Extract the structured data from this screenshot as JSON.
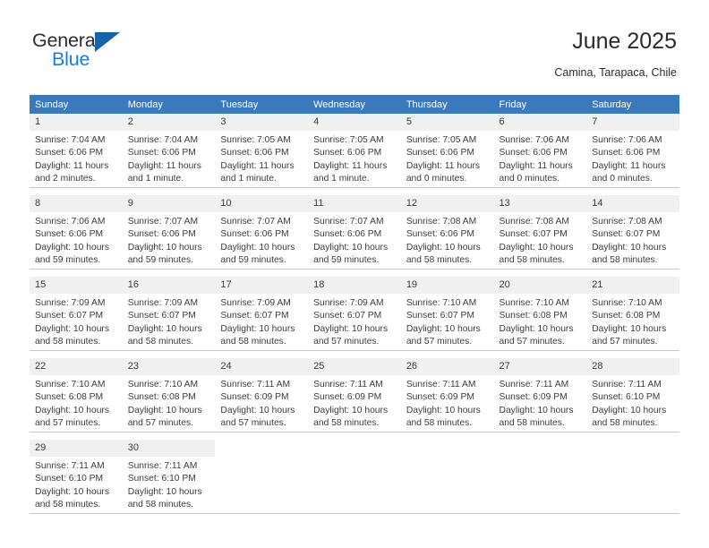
{
  "brand": {
    "name_top": "General",
    "name_bottom": "Blue",
    "accent_color": "#1a7fd4",
    "triangle_color": "#1565a8"
  },
  "header": {
    "title": "June 2025",
    "location": "Camina, Tarapaca, Chile"
  },
  "calendar": {
    "header_bg": "#3b79bd",
    "daynum_bg": "#f0f0f0",
    "weekdays": [
      "Sunday",
      "Monday",
      "Tuesday",
      "Wednesday",
      "Thursday",
      "Friday",
      "Saturday"
    ],
    "weeks": [
      [
        {
          "day": "1",
          "sunrise": "Sunrise: 7:04 AM",
          "sunset": "Sunset: 6:06 PM",
          "daylight1": "Daylight: 11 hours",
          "daylight2": "and 2 minutes."
        },
        {
          "day": "2",
          "sunrise": "Sunrise: 7:04 AM",
          "sunset": "Sunset: 6:06 PM",
          "daylight1": "Daylight: 11 hours",
          "daylight2": "and 1 minute."
        },
        {
          "day": "3",
          "sunrise": "Sunrise: 7:05 AM",
          "sunset": "Sunset: 6:06 PM",
          "daylight1": "Daylight: 11 hours",
          "daylight2": "and 1 minute."
        },
        {
          "day": "4",
          "sunrise": "Sunrise: 7:05 AM",
          "sunset": "Sunset: 6:06 PM",
          "daylight1": "Daylight: 11 hours",
          "daylight2": "and 1 minute."
        },
        {
          "day": "5",
          "sunrise": "Sunrise: 7:05 AM",
          "sunset": "Sunset: 6:06 PM",
          "daylight1": "Daylight: 11 hours",
          "daylight2": "and 0 minutes."
        },
        {
          "day": "6",
          "sunrise": "Sunrise: 7:06 AM",
          "sunset": "Sunset: 6:06 PM",
          "daylight1": "Daylight: 11 hours",
          "daylight2": "and 0 minutes."
        },
        {
          "day": "7",
          "sunrise": "Sunrise: 7:06 AM",
          "sunset": "Sunset: 6:06 PM",
          "daylight1": "Daylight: 11 hours",
          "daylight2": "and 0 minutes."
        }
      ],
      [
        {
          "day": "8",
          "sunrise": "Sunrise: 7:06 AM",
          "sunset": "Sunset: 6:06 PM",
          "daylight1": "Daylight: 10 hours",
          "daylight2": "and 59 minutes."
        },
        {
          "day": "9",
          "sunrise": "Sunrise: 7:07 AM",
          "sunset": "Sunset: 6:06 PM",
          "daylight1": "Daylight: 10 hours",
          "daylight2": "and 59 minutes."
        },
        {
          "day": "10",
          "sunrise": "Sunrise: 7:07 AM",
          "sunset": "Sunset: 6:06 PM",
          "daylight1": "Daylight: 10 hours",
          "daylight2": "and 59 minutes."
        },
        {
          "day": "11",
          "sunrise": "Sunrise: 7:07 AM",
          "sunset": "Sunset: 6:06 PM",
          "daylight1": "Daylight: 10 hours",
          "daylight2": "and 59 minutes."
        },
        {
          "day": "12",
          "sunrise": "Sunrise: 7:08 AM",
          "sunset": "Sunset: 6:06 PM",
          "daylight1": "Daylight: 10 hours",
          "daylight2": "and 58 minutes."
        },
        {
          "day": "13",
          "sunrise": "Sunrise: 7:08 AM",
          "sunset": "Sunset: 6:07 PM",
          "daylight1": "Daylight: 10 hours",
          "daylight2": "and 58 minutes."
        },
        {
          "day": "14",
          "sunrise": "Sunrise: 7:08 AM",
          "sunset": "Sunset: 6:07 PM",
          "daylight1": "Daylight: 10 hours",
          "daylight2": "and 58 minutes."
        }
      ],
      [
        {
          "day": "15",
          "sunrise": "Sunrise: 7:09 AM",
          "sunset": "Sunset: 6:07 PM",
          "daylight1": "Daylight: 10 hours",
          "daylight2": "and 58 minutes."
        },
        {
          "day": "16",
          "sunrise": "Sunrise: 7:09 AM",
          "sunset": "Sunset: 6:07 PM",
          "daylight1": "Daylight: 10 hours",
          "daylight2": "and 58 minutes."
        },
        {
          "day": "17",
          "sunrise": "Sunrise: 7:09 AM",
          "sunset": "Sunset: 6:07 PM",
          "daylight1": "Daylight: 10 hours",
          "daylight2": "and 58 minutes."
        },
        {
          "day": "18",
          "sunrise": "Sunrise: 7:09 AM",
          "sunset": "Sunset: 6:07 PM",
          "daylight1": "Daylight: 10 hours",
          "daylight2": "and 57 minutes."
        },
        {
          "day": "19",
          "sunrise": "Sunrise: 7:10 AM",
          "sunset": "Sunset: 6:07 PM",
          "daylight1": "Daylight: 10 hours",
          "daylight2": "and 57 minutes."
        },
        {
          "day": "20",
          "sunrise": "Sunrise: 7:10 AM",
          "sunset": "Sunset: 6:08 PM",
          "daylight1": "Daylight: 10 hours",
          "daylight2": "and 57 minutes."
        },
        {
          "day": "21",
          "sunrise": "Sunrise: 7:10 AM",
          "sunset": "Sunset: 6:08 PM",
          "daylight1": "Daylight: 10 hours",
          "daylight2": "and 57 minutes."
        }
      ],
      [
        {
          "day": "22",
          "sunrise": "Sunrise: 7:10 AM",
          "sunset": "Sunset: 6:08 PM",
          "daylight1": "Daylight: 10 hours",
          "daylight2": "and 57 minutes."
        },
        {
          "day": "23",
          "sunrise": "Sunrise: 7:10 AM",
          "sunset": "Sunset: 6:08 PM",
          "daylight1": "Daylight: 10 hours",
          "daylight2": "and 57 minutes."
        },
        {
          "day": "24",
          "sunrise": "Sunrise: 7:11 AM",
          "sunset": "Sunset: 6:09 PM",
          "daylight1": "Daylight: 10 hours",
          "daylight2": "and 57 minutes."
        },
        {
          "day": "25",
          "sunrise": "Sunrise: 7:11 AM",
          "sunset": "Sunset: 6:09 PM",
          "daylight1": "Daylight: 10 hours",
          "daylight2": "and 58 minutes."
        },
        {
          "day": "26",
          "sunrise": "Sunrise: 7:11 AM",
          "sunset": "Sunset: 6:09 PM",
          "daylight1": "Daylight: 10 hours",
          "daylight2": "and 58 minutes."
        },
        {
          "day": "27",
          "sunrise": "Sunrise: 7:11 AM",
          "sunset": "Sunset: 6:09 PM",
          "daylight1": "Daylight: 10 hours",
          "daylight2": "and 58 minutes."
        },
        {
          "day": "28",
          "sunrise": "Sunrise: 7:11 AM",
          "sunset": "Sunset: 6:10 PM",
          "daylight1": "Daylight: 10 hours",
          "daylight2": "and 58 minutes."
        }
      ],
      [
        {
          "day": "29",
          "sunrise": "Sunrise: 7:11 AM",
          "sunset": "Sunset: 6:10 PM",
          "daylight1": "Daylight: 10 hours",
          "daylight2": "and 58 minutes."
        },
        {
          "day": "30",
          "sunrise": "Sunrise: 7:11 AM",
          "sunset": "Sunset: 6:10 PM",
          "daylight1": "Daylight: 10 hours",
          "daylight2": "and 58 minutes."
        },
        {
          "day": "",
          "sunrise": "",
          "sunset": "",
          "daylight1": "",
          "daylight2": ""
        },
        {
          "day": "",
          "sunrise": "",
          "sunset": "",
          "daylight1": "",
          "daylight2": ""
        },
        {
          "day": "",
          "sunrise": "",
          "sunset": "",
          "daylight1": "",
          "daylight2": ""
        },
        {
          "day": "",
          "sunrise": "",
          "sunset": "",
          "daylight1": "",
          "daylight2": ""
        },
        {
          "day": "",
          "sunrise": "",
          "sunset": "",
          "daylight1": "",
          "daylight2": ""
        }
      ]
    ]
  }
}
